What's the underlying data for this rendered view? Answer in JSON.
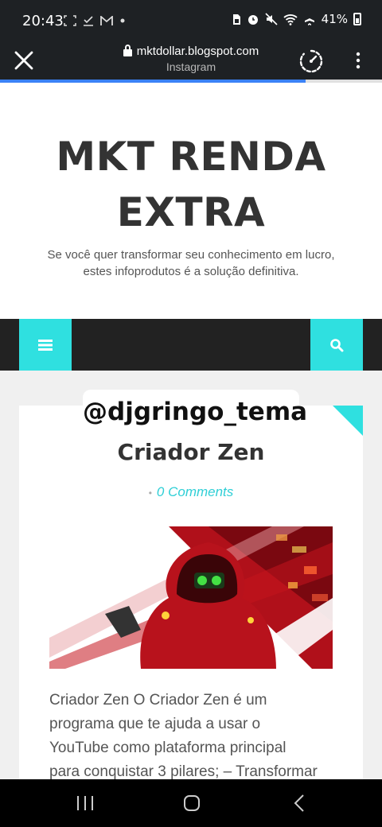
{
  "status_bar": {
    "time": "20:43",
    "battery": "41%",
    "left_icons": [
      "screenshot-icon",
      "download-icon",
      "gmail-icon",
      "dot-icon"
    ],
    "right_icons": [
      "sim-icon",
      "alarm-icon",
      "mute-icon",
      "wifi-icon",
      "airplane-icon",
      "battery-icon"
    ]
  },
  "browser": {
    "url": "mktdollar.blogspot.com",
    "subtitle": "Instagram",
    "progress_fraction": 0.8
  },
  "site": {
    "title_line1": "MKT RENDA",
    "title_line2": "EXTRA",
    "description_line1": "Se você quer transformar seu conhecimento em lucro,",
    "description_line2": "estes infoprodutos é a solução definitiva."
  },
  "overlay": {
    "instagram_handle": "@djgringo_tema"
  },
  "post": {
    "title": "Criador Zen",
    "comments_dot": "•",
    "comments": "0 Comments",
    "excerpt_line1": "Criador Zen O Criador Zen é um",
    "excerpt_line2": "programa que te ajuda a usar o",
    "excerpt_line3": "YouTube como plataforma principal",
    "excerpt_line4": "para conquistar 3 pilares; – Transformar"
  },
  "colors": {
    "accent": "#2fe0e0",
    "navbar": "#222222",
    "link": "#2fcfd6",
    "progress": "#3b82f6"
  }
}
